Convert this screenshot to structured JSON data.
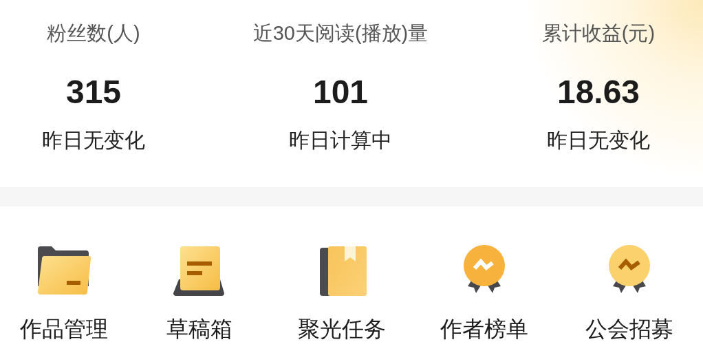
{
  "stats": [
    {
      "label": "粉丝数(人)",
      "value": "315",
      "change": "昨日无变化"
    },
    {
      "label": "近30天阅读(播放)量",
      "value": "101",
      "change": "昨日计算中"
    },
    {
      "label": "累计收益(元)",
      "value": "18.63",
      "change": "昨日无变化"
    }
  ],
  "tools": [
    {
      "kind": "folder",
      "label": "作品管理"
    },
    {
      "kind": "draft",
      "label": "草稿箱"
    },
    {
      "kind": "book",
      "label": "聚光任务"
    },
    {
      "kind": "medal-bright",
      "label": "作者榜单"
    },
    {
      "kind": "medal-pale",
      "label": "公会招募"
    }
  ]
}
